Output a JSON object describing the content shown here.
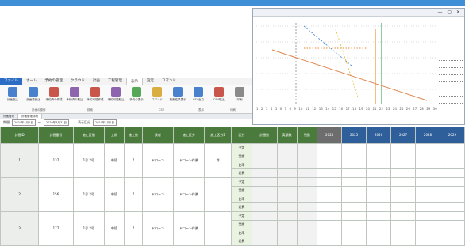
{
  "menubar": [
    "ファイル",
    "ホーム",
    "予約の管理",
    "クラウド",
    "計画",
    "工程管理",
    "表示",
    "設定",
    "コマンド"
  ],
  "ribbon": {
    "buttons": [
      "計画取込",
      "計画再読込",
      "予約済の作成",
      "予約済の取込",
      "予約可能作成",
      "予約可能取込",
      "予約の表示",
      "コマンド",
      "検索結果表示",
      "CSV出力",
      "CSV取込",
      "印刷"
    ],
    "groups": [
      "計画の操作",
      "検索",
      "CSV",
      "表示",
      "印刷"
    ]
  },
  "tabs": [
    "計画管理",
    "計画管理詳細"
  ],
  "filter": {
    "label1": "期間",
    "from": "2024年4月1日",
    "sep": "〜",
    "to": "2029年3月31日",
    "label2": "表示区分",
    "mode": "2024年4月1日"
  },
  "chart_window": {
    "window_buttons": "— ▢ ✕",
    "xtick_labels": [
      "1",
      "2",
      "3",
      "4",
      "5",
      "6",
      "7",
      "8",
      "9",
      "10",
      "11",
      "12",
      "13",
      "14",
      "15",
      "16",
      "17",
      "18",
      "19",
      "20",
      "21",
      "22",
      "23",
      "24",
      "25",
      "26",
      "27",
      "28",
      "29",
      "30"
    ]
  },
  "table": {
    "headers": [
      "計画ID",
      "計画番号",
      "施工区間",
      "工期",
      "施工数",
      "業者",
      "施工区分",
      "施工区分2",
      "区分",
      "計画数",
      "実績数",
      "残数",
      "2024",
      "2025",
      "2026",
      "2027",
      "2028",
      "2029"
    ],
    "rows": [
      {
        "no": "1",
        "code": "137",
        "sect": "1号\n2号",
        "kind": "中段",
        "num": "7",
        "worker": "ドローン",
        "type": "ドローン作業",
        "cat": "群",
        "sub": [
          "予定",
          "実績",
          "比率",
          "差異"
        ]
      },
      {
        "no": "2",
        "code": "156",
        "sect": "1号\n2号",
        "kind": "中段",
        "num": "7",
        "worker": "ドローン",
        "type": "ドローン作業",
        "cat": "",
        "sub": [
          "予定",
          "実績",
          "比率",
          "差異"
        ]
      },
      {
        "no": "3",
        "code": "177",
        "sect": "1号\n2号",
        "kind": "中段",
        "num": "7",
        "worker": "ドローン",
        "type": "ドローン作業",
        "cat": "",
        "sub": [
          "予定",
          "実績",
          "比率",
          "差異"
        ]
      }
    ]
  },
  "colors": {
    "header_green": "#4a7a3c",
    "header_blue": "#2f5f9a",
    "accent": "#2b6cc4"
  }
}
